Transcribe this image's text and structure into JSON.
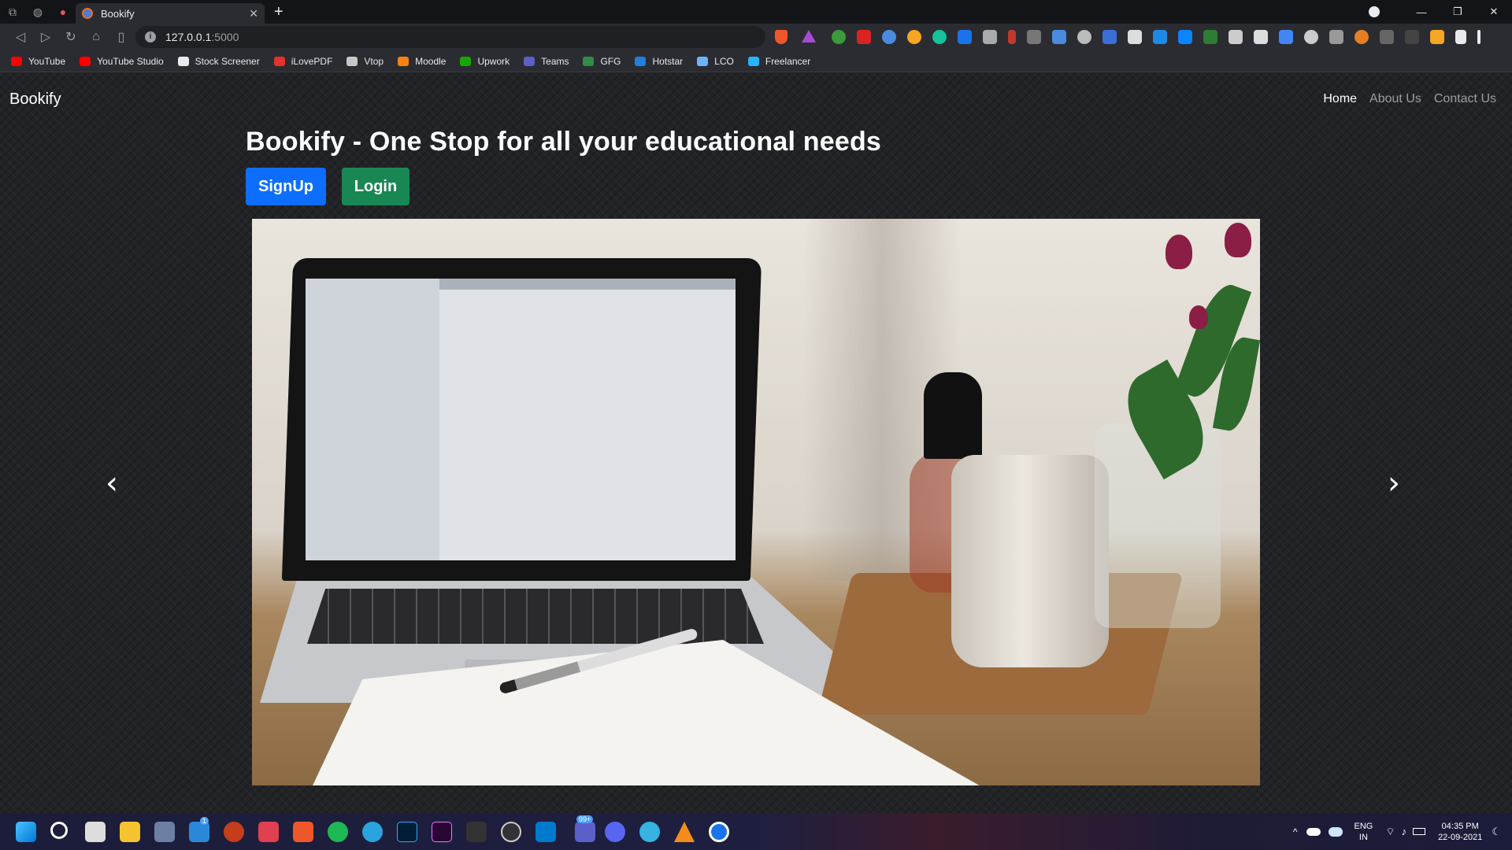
{
  "browser": {
    "tab_title": "Bookify",
    "url_host": "127.0.0.1",
    "url_port": ":5000",
    "bookmarks": [
      {
        "label": "YouTube",
        "color": "#ff0000"
      },
      {
        "label": "YouTube Studio",
        "color": "#ff0000"
      },
      {
        "label": "Stock Screener",
        "color": "#e8eaed"
      },
      {
        "label": "iLovePDF",
        "color": "#e5322d"
      },
      {
        "label": "Vtop",
        "color": "#c7c7c7"
      },
      {
        "label": "Moodle",
        "color": "#f98012"
      },
      {
        "label": "Upwork",
        "color": "#14a800"
      },
      {
        "label": "Teams",
        "color": "#5b5fc7"
      },
      {
        "label": "GFG",
        "color": "#2f8d46"
      },
      {
        "label": "Hotstar",
        "color": "#1f80e0"
      },
      {
        "label": "LCO",
        "color": "#6cb4ff"
      },
      {
        "label": "Freelancer",
        "color": "#29b2fe"
      }
    ]
  },
  "site": {
    "brand": "Bookify",
    "nav": {
      "home": "Home",
      "about": "About Us",
      "contact": "Contact Us"
    },
    "hero_title": "Bookify - One Stop for all your educational needs",
    "signup_label": "SignUp",
    "login_label": "Login",
    "prev_glyph": "‹",
    "next_glyph": "›"
  },
  "system": {
    "lang_line1": "ENG",
    "lang_line2": "IN",
    "time": "04:35 PM",
    "date": "22-09-2021",
    "mail_badge": "1",
    "teams_badge": "99+"
  },
  "colors": {
    "signup": "#0d6efd",
    "login": "#198754"
  }
}
